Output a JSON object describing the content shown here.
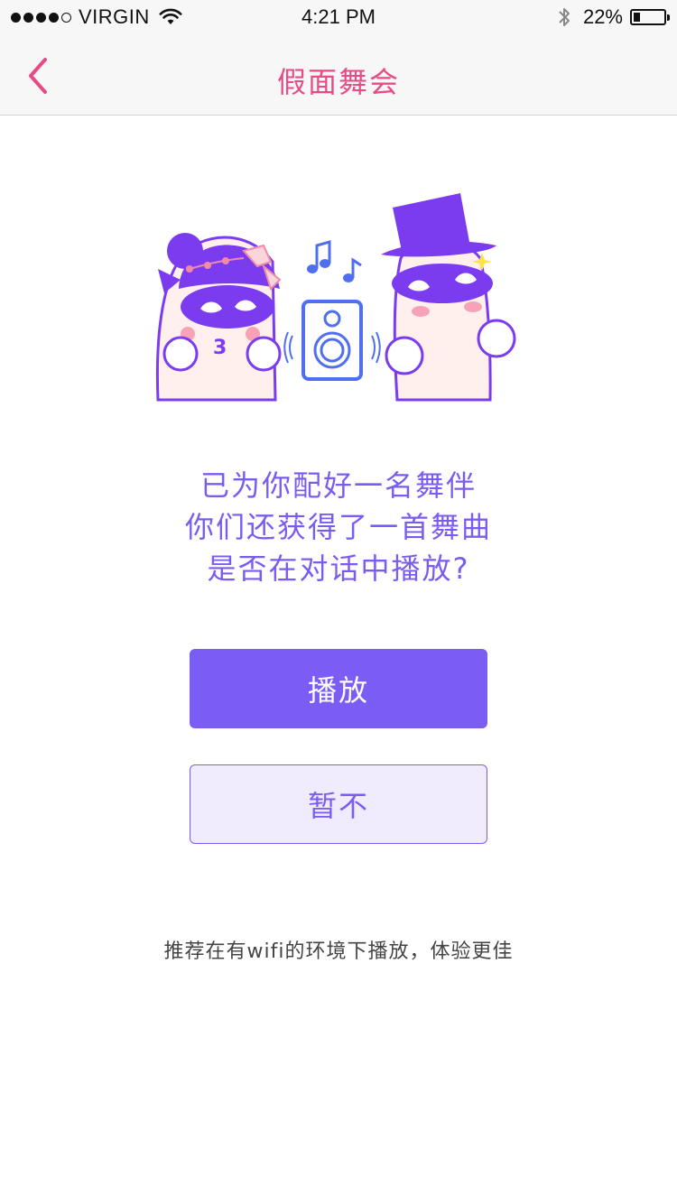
{
  "status_bar": {
    "carrier": "VIRGIN",
    "time": "4:21 PM",
    "battery_percent": "22%",
    "battery_level": 0.22,
    "signal_bars_filled": 4,
    "signal_bars_total": 5
  },
  "nav": {
    "title": "假面舞会",
    "back_icon": "chevron-left-icon"
  },
  "colors": {
    "accent_purple": "#7b5cf5",
    "title_pink": "#e74c86",
    "prompt_purple": "#7a5cf0"
  },
  "prompt": {
    "lines": [
      "已为你配好一名舞伴",
      "你们还获得了一首舞曲",
      "是否在对话中播放?"
    ]
  },
  "buttons": {
    "play_label": "播放",
    "skip_label": "暂不"
  },
  "footer": {
    "note": "推荐在有wifi的环境下播放，体验更佳"
  }
}
